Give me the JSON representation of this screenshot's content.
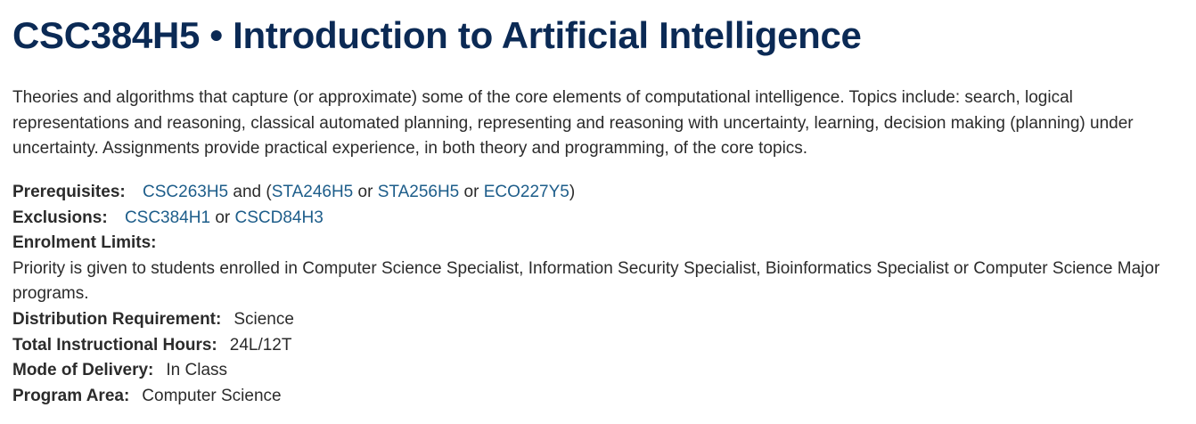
{
  "course": {
    "title": "CSC384H5 • Introduction to Artificial Intelligence",
    "description": "Theories and algorithms that capture (or approximate) some of the core elements of computational intelligence. Topics include: search, logical representations and reasoning, classical automated planning, representing and reasoning with uncertainty, learning, decision making (planning) under uncertainty. Assignments provide practical experience, in both theory and programming, of the core topics."
  },
  "prerequisites": {
    "label": "Prerequisites:",
    "link1": "CSC263H5",
    "text1": "and (",
    "link2": "STA246H5",
    "text2": "or",
    "link3": "STA256H5",
    "text3": "or",
    "link4": "ECO227Y5",
    "text4": ")"
  },
  "exclusions": {
    "label": "Exclusions:",
    "link1": "CSC384H1",
    "text1": "or",
    "link2": "CSCD84H3"
  },
  "enrolment": {
    "label": "Enrolment Limits:",
    "text": "Priority is given to students enrolled in Computer Science Specialist, Information Security Specialist, Bioinformatics Specialist or Computer Science Major programs."
  },
  "distribution": {
    "label": "Distribution Requirement:",
    "value": "Science"
  },
  "hours": {
    "label": "Total Instructional Hours:",
    "value": "24L/12T"
  },
  "delivery": {
    "label": "Mode of Delivery:",
    "value": "In Class"
  },
  "program_area": {
    "label": "Program Area:",
    "value": "Computer Science"
  }
}
